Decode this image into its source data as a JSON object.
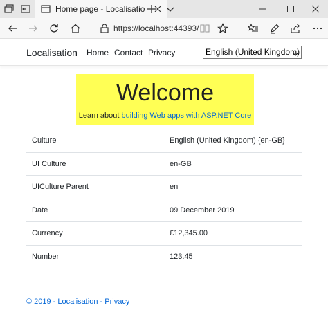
{
  "browser": {
    "tab_title": "Home page - Localisatio",
    "url": "https://localhost:44393/"
  },
  "nav": {
    "brand": "Localisation",
    "links": [
      "Home",
      "Contact",
      "Privacy"
    ],
    "culture_selected": "English (United Kingdom)"
  },
  "banner": {
    "title": "Welcome",
    "subtitle_prefix": "Learn about ",
    "subtitle_link": "building Web apps with ASP.NET Core",
    "background": "#ffff55"
  },
  "table": {
    "rows": [
      {
        "key": "Culture",
        "value": "English (United Kingdom) {en-GB}"
      },
      {
        "key": "UI Culture",
        "value": "en-GB"
      },
      {
        "key": "UICulture Parent",
        "value": "en"
      },
      {
        "key": "Date",
        "value": "09 December 2019"
      },
      {
        "key": "Currency",
        "value": "£12,345.00"
      },
      {
        "key": "Number",
        "value": "123.45"
      }
    ]
  },
  "footer": {
    "copyright": "© 2019 - Localisation - ",
    "privacy_link": "Privacy"
  },
  "colors": {
    "link": "#0366d6",
    "banner": "#ffff55"
  },
  "icons": [
    "tab-actions-icon",
    "set-aside-icon",
    "page-icon",
    "close-icon",
    "plus-icon",
    "chevron-down-icon",
    "minimize-icon",
    "maximize-icon",
    "back-arrow-icon",
    "forward-arrow-icon",
    "refresh-icon",
    "home-icon",
    "lock-icon",
    "reading-view-icon",
    "star-icon",
    "favorites-icon",
    "pen-icon",
    "share-icon",
    "more-icon"
  ]
}
